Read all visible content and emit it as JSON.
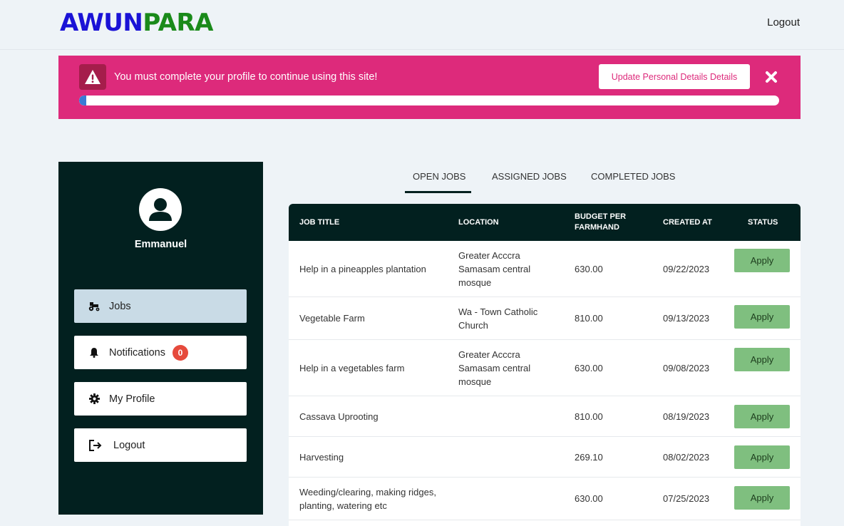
{
  "header": {
    "logo_part1": "AWUN",
    "logo_part2": "PARA",
    "logout_label": "Logout"
  },
  "alert": {
    "message": "You must complete your profile to continue using this site!",
    "button_label": "Update Personal Details Details",
    "progress": 0.01,
    "icon": "warning-icon",
    "close_icon": "close-icon",
    "color": "#dd2a7b"
  },
  "sidebar": {
    "username": "Emmanuel",
    "items": [
      {
        "label": "Jobs",
        "icon": "tractor-icon",
        "active": true
      },
      {
        "label": "Notifications",
        "icon": "bell-icon",
        "badge": "0"
      },
      {
        "label": "My Profile",
        "icon": "gear-icon"
      },
      {
        "label": "Logout",
        "icon": "sign-out-icon"
      }
    ]
  },
  "tabs": [
    {
      "label": "OPEN JOBS",
      "active": true
    },
    {
      "label": "ASSIGNED JOBS"
    },
    {
      "label": "COMPLETED JOBS"
    }
  ],
  "table": {
    "columns": [
      "JOB TITLE",
      "LOCATION",
      "BUDGET PER FARMHAND",
      "CREATED AT",
      "STATUS"
    ],
    "rows": [
      {
        "title": "Help in a pineapples plantation",
        "location": "Greater Acccra Samasam central mosque",
        "budget": "630.00",
        "created": "09/22/2023",
        "status": "Apply"
      },
      {
        "title": "Vegetable Farm",
        "location": "Wa - Town Catholic Church",
        "budget": "810.00",
        "created": "09/13/2023",
        "status": "Apply"
      },
      {
        "title": "Help in a vegetables farm",
        "location": "Greater Acccra Samasam central mosque",
        "budget": "630.00",
        "created": "09/08/2023",
        "status": "Apply"
      },
      {
        "title": "Cassava Uprooting",
        "location": "",
        "budget": "810.00",
        "created": "08/19/2023",
        "status": "Apply"
      },
      {
        "title": "Harvesting",
        "location": "",
        "budget": "269.10",
        "created": "08/02/2023",
        "status": "Apply"
      },
      {
        "title": "Weeding/clearing, making ridges, planting, watering etc",
        "location": "",
        "budget": "630.00",
        "created": "07/25/2023",
        "status": "Apply"
      }
    ]
  }
}
